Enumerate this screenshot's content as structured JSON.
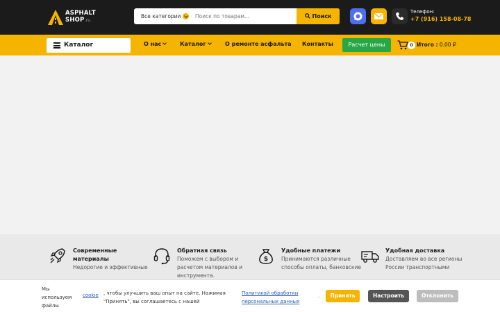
{
  "header": {
    "logo_line1": "ASPHALT",
    "logo_line2": "SHOP",
    "logo_suffix": ".ru",
    "search": {
      "category_label": "Все категории",
      "placeholder": "Поиск по товарам...",
      "button_label": "Поиск"
    },
    "phone_label": "Телефон:",
    "phone_number": "+7 (916) 158-08-78"
  },
  "nav": {
    "catalog_button": "Каталог",
    "items": [
      "О нас",
      "Каталог",
      "О ремонте асфальта",
      "Контакты"
    ],
    "calc_button": "Расчет цены",
    "cart_count": "0",
    "cart_total_label": "Итого :",
    "cart_total_value": "0.00 ₽"
  },
  "features": [
    {
      "icon": "rocket-icon",
      "title": "Современные материалы",
      "description": "Недорогие и эффективные"
    },
    {
      "icon": "headset-icon",
      "title": "Обратная связь",
      "description": "Поможем с выбором и расчетом материалов и инструмента."
    },
    {
      "icon": "money-bag-icon",
      "title": "Удобные платежи",
      "description": "Принимаются различные способы оплаты, банковские"
    },
    {
      "icon": "truck-icon",
      "title": "Удобная доставка",
      "description": "Доставляем во все регионы России транспортными"
    }
  ],
  "cookie": {
    "text_before": "Мы используем файлы",
    "cookie_link": "cookie",
    "text_after": ", чтобы улучшить ваш опыт на сайте. Нажимая \"Принять\", вы соглашаетесь с нашей",
    "policy_link": "Политикой обработки персональных данных",
    "dot": ".",
    "accept": "Принять",
    "configure": "Настроить",
    "decline": "Отклонить"
  },
  "colors": {
    "brand": "#f5b400",
    "dark": "#1b1b1b",
    "green": "#28a745"
  }
}
